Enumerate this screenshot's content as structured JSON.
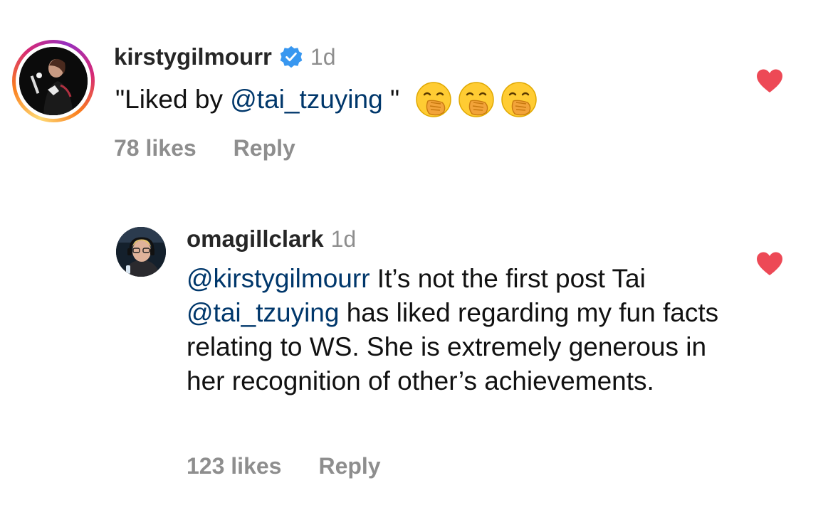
{
  "comments": [
    {
      "username": "kirstygilmourr",
      "verified": true,
      "time": "1d",
      "text_prefix": "\"Liked by ",
      "mention": "@tai_tzuying",
      "text_suffix": " \"",
      "emojis": [
        "face-with-hand-over-mouth",
        "face-with-hand-over-mouth",
        "face-with-hand-over-mouth"
      ],
      "likes": "78 likes",
      "reply_label": "Reply",
      "liked": true
    },
    {
      "username": "omagillclark",
      "verified": false,
      "time": "1d",
      "mention1": "@kirstygilmourr",
      "text1": " It’s not the first post Tai ",
      "mention2": "@tai_tzuying",
      "text2": " has liked regarding my fun facts relating to WS. She is extremely generous in her recognition of other’s achievements.",
      "likes": "123 likes",
      "reply_label": "Reply",
      "liked": true
    }
  ],
  "colors": {
    "heart": "#ed4956",
    "verified": "#3897f0",
    "mention": "#00376b",
    "meta": "#8e8e8e"
  }
}
